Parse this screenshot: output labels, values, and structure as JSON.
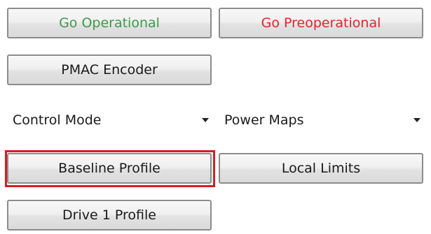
{
  "colors": {
    "go_operational_text": "#3a9b4a",
    "go_preoperational_text": "#e0252b",
    "default_text": "#1a1a1a",
    "highlight": "#d91c24"
  },
  "buttons": {
    "go_operational": "Go Operational",
    "go_preoperational": "Go Preoperational",
    "pmac_encoder": "PMAC Encoder",
    "baseline_profile": "Baseline Profile",
    "local_limits": "Local Limits",
    "drive1_profile": "Drive 1 Profile"
  },
  "dropdowns": {
    "control_mode": {
      "value": "Control Mode",
      "icon": "chevron-down-icon"
    },
    "power_maps": {
      "value": "Power Maps",
      "icon": "chevron-down-icon"
    }
  }
}
